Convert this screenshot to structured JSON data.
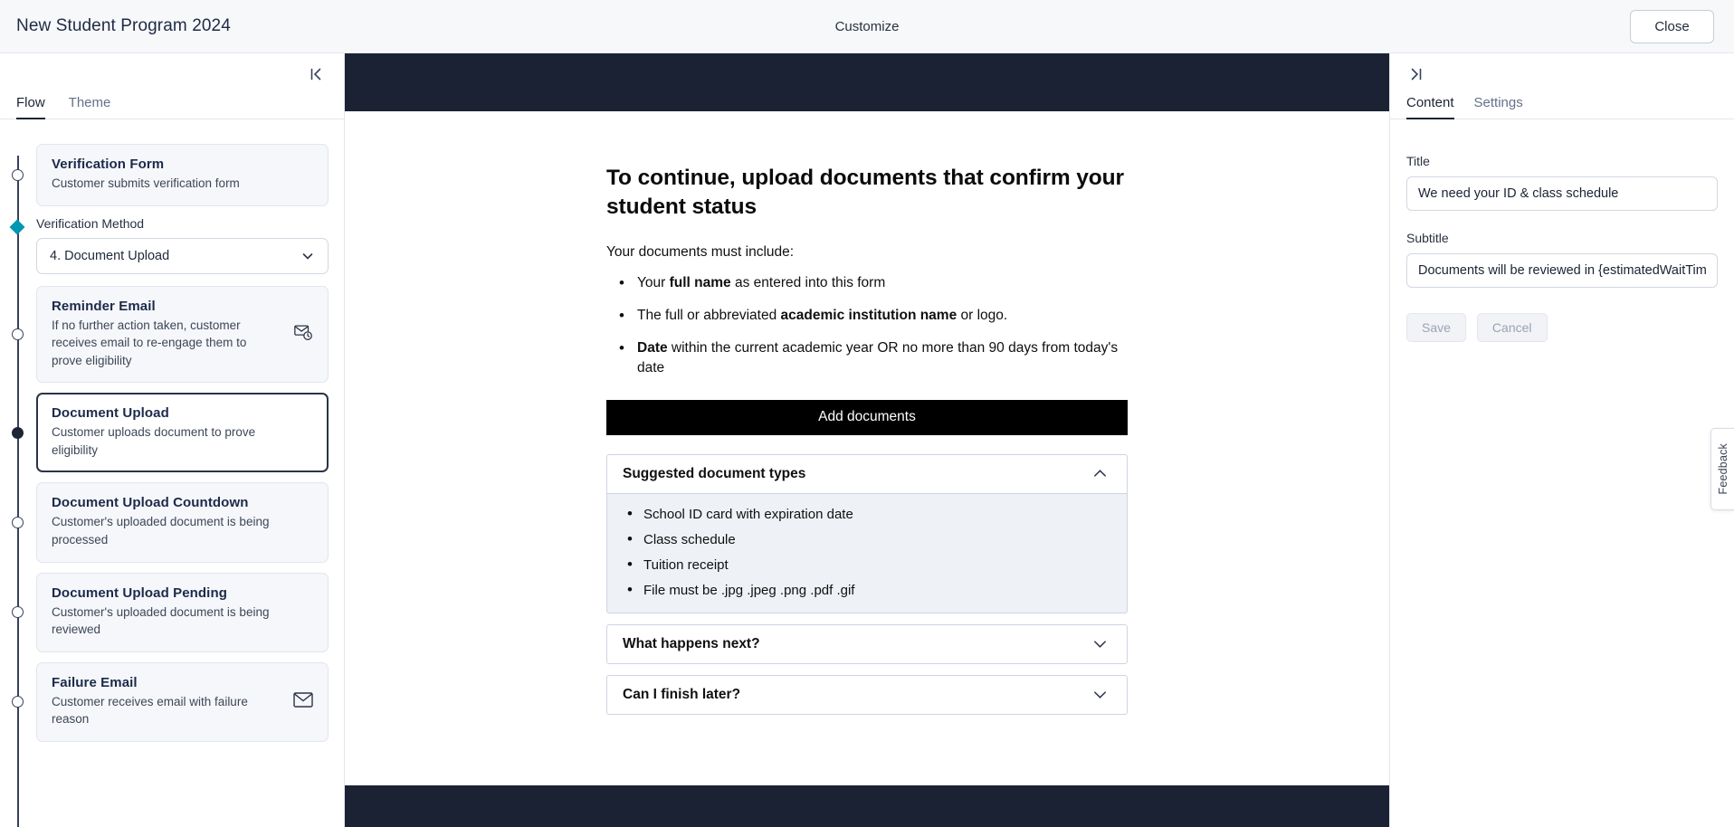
{
  "topbar": {
    "title": "New Student Program 2024",
    "center_label": "Customize",
    "close_label": "Close"
  },
  "sidebar": {
    "collapse_icon": "collapse-panel-icon",
    "tabs": [
      {
        "label": "Flow",
        "active": true
      },
      {
        "label": "Theme",
        "active": false
      }
    ],
    "method": {
      "label": "Verification Method",
      "selected": "4. Document Upload",
      "chevron": "chevron-down-icon"
    },
    "steps": [
      {
        "title": "Verification Form",
        "desc": "Customer submits verification form",
        "node": "ring",
        "selected": false,
        "icon": null
      },
      {
        "title": "Reminder Email",
        "desc": "If no further action taken, customer receives email to re-engage them to prove eligibility",
        "node": "ring",
        "selected": false,
        "icon": "email-clock-icon"
      },
      {
        "title": "Document Upload",
        "desc": "Customer uploads document to prove eligibility",
        "node": "dot",
        "selected": true,
        "icon": null
      },
      {
        "title": "Document Upload Countdown",
        "desc": "Customer's uploaded document is being processed",
        "node": "ring",
        "selected": false,
        "icon": null
      },
      {
        "title": "Document Upload Pending",
        "desc": "Customer's uploaded document is being reviewed",
        "node": "ring",
        "selected": false,
        "icon": null
      },
      {
        "title": "Failure Email",
        "desc": "Customer receives email with failure reason",
        "node": "ring",
        "selected": false,
        "icon": "email-icon"
      }
    ]
  },
  "preview": {
    "heading": "To continue, upload documents that confirm your student status",
    "intro": "Your documents must include:",
    "requirements": [
      {
        "pre": "Your ",
        "bold": "full name",
        "post": " as entered into this form"
      },
      {
        "pre": "The full or abbreviated ",
        "bold": "academic institution name",
        "post": " or logo."
      },
      {
        "pre": "",
        "bold": "Date",
        "post": " within the current academic year OR no more than 90 days from today's date"
      }
    ],
    "add_documents_label": "Add documents",
    "accordions": [
      {
        "title": "Suggested document types",
        "open": true,
        "chevron": "chevron-up-icon",
        "items": [
          "School ID card with expiration date",
          "Class schedule",
          "Tuition receipt",
          "File must be .jpg .jpeg .png .pdf .gif"
        ]
      },
      {
        "title": "What happens next?",
        "open": false,
        "chevron": "chevron-down-icon",
        "items": []
      },
      {
        "title": "Can I finish later?",
        "open": false,
        "chevron": "chevron-down-icon",
        "items": []
      }
    ]
  },
  "rightpanel": {
    "expand_icon": "expand-panel-icon",
    "tabs": [
      {
        "label": "Content",
        "active": true
      },
      {
        "label": "Settings",
        "active": false
      }
    ],
    "title_label": "Title",
    "title_value": "We need your ID & class schedule",
    "subtitle_label": "Subtitle",
    "subtitle_value": "Documents will be reviewed in {estimatedWaitTime}",
    "save_label": "Save",
    "cancel_label": "Cancel",
    "feedback_label": "Feedback"
  },
  "colors": {
    "accent_teal": "#0097b2",
    "dark_navy": "#1b2233",
    "button_black": "#000000",
    "panel_bg": "#f5f7fa"
  }
}
